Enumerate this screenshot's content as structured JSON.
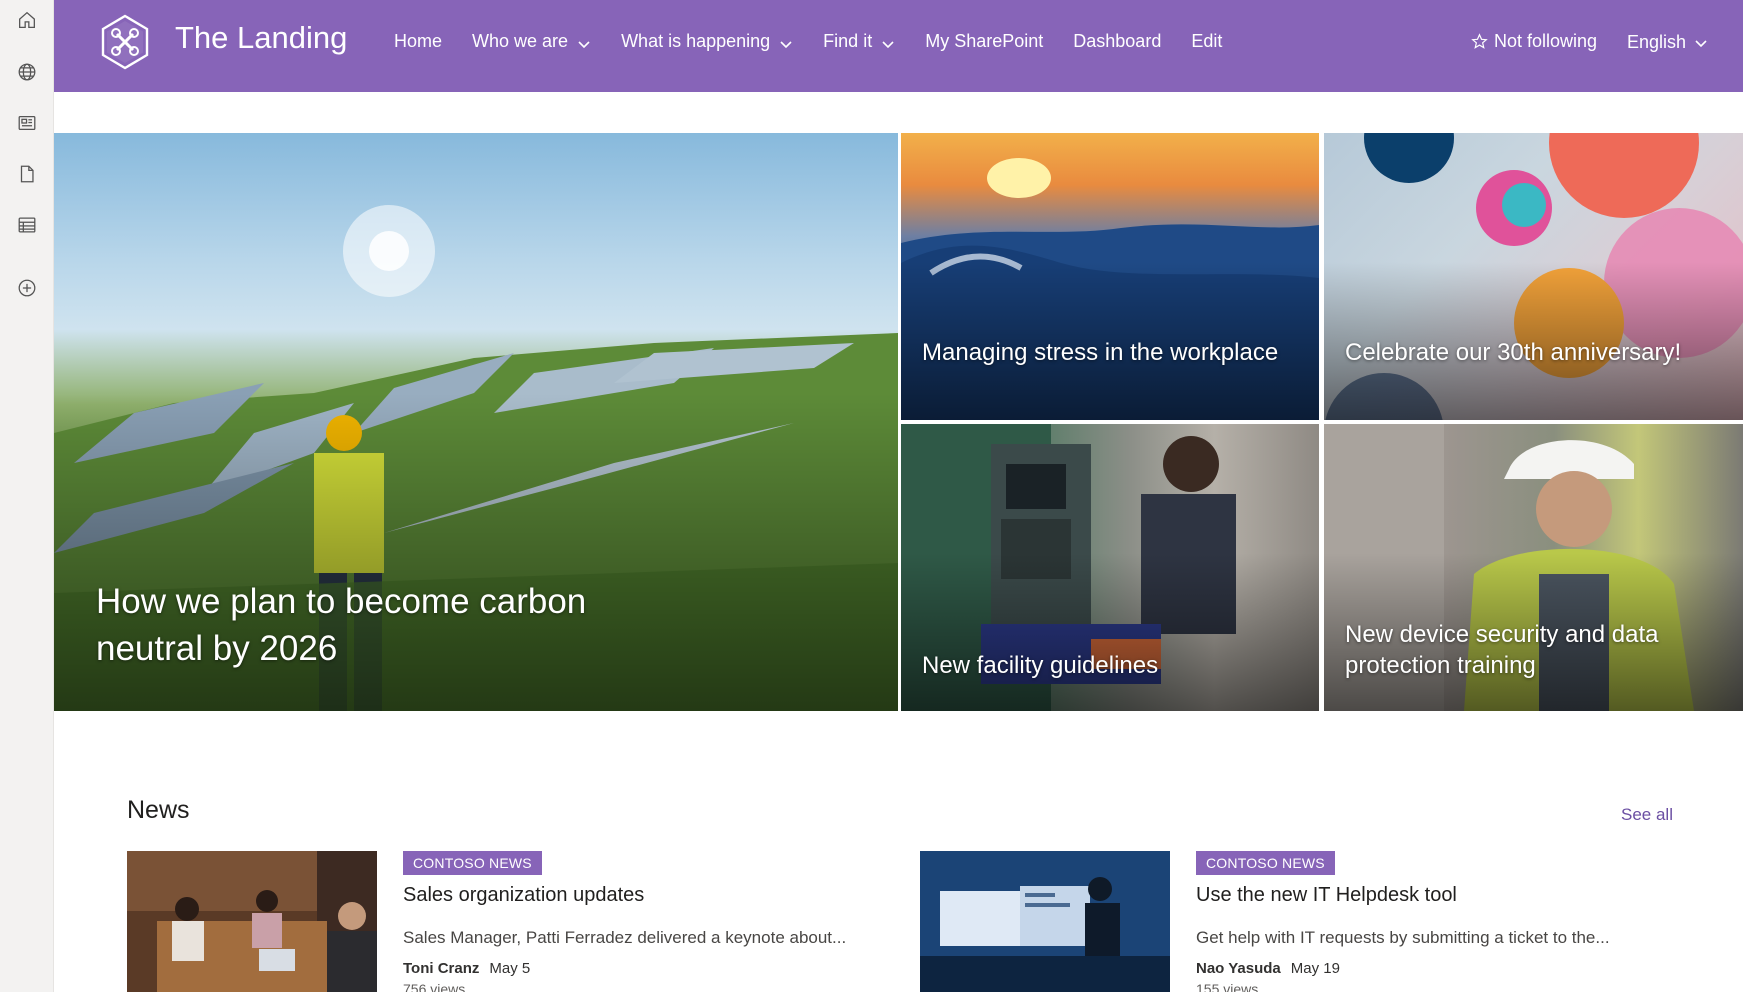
{
  "site": {
    "title": "The Landing"
  },
  "nav": [
    {
      "label": "Home",
      "has_dropdown": false
    },
    {
      "label": "Who we are",
      "has_dropdown": true
    },
    {
      "label": "What is happening",
      "has_dropdown": true
    },
    {
      "label": "Find it",
      "has_dropdown": true
    },
    {
      "label": "My SharePoint",
      "has_dropdown": false
    },
    {
      "label": "Dashboard",
      "has_dropdown": false
    },
    {
      "label": "Edit",
      "has_dropdown": false
    }
  ],
  "header_right": {
    "follow_label": "Not following",
    "language": "English"
  },
  "appbar": [
    "home-icon",
    "globe-icon",
    "news-icon",
    "document-icon",
    "list-icon",
    "add-icon"
  ],
  "hero": {
    "main": "How we plan to become carbon neutral by 2026",
    "stress": "Managing stress in the workplace",
    "anniversary": "Celebrate our 30th anniversary!",
    "facility": "New facility guidelines",
    "security": "New device security and data protection training"
  },
  "news": {
    "title": "News",
    "see_all": "See all",
    "items": [
      {
        "badge": "CONTOSO NEWS",
        "headline": "Sales organization updates",
        "description": "Sales Manager, Patti Ferradez delivered a keynote about...",
        "author": "Toni Cranz",
        "date": "May 5",
        "views": "756 views"
      },
      {
        "badge": "CONTOSO NEWS",
        "headline": "Use the new IT Helpdesk tool",
        "description": "Get help with IT requests by submitting a ticket to the...",
        "author": "Nao Yasuda",
        "date": "May 19",
        "views": "155 views"
      }
    ]
  },
  "colors": {
    "brand": "#8764b8",
    "link": "#6b4fa3"
  }
}
